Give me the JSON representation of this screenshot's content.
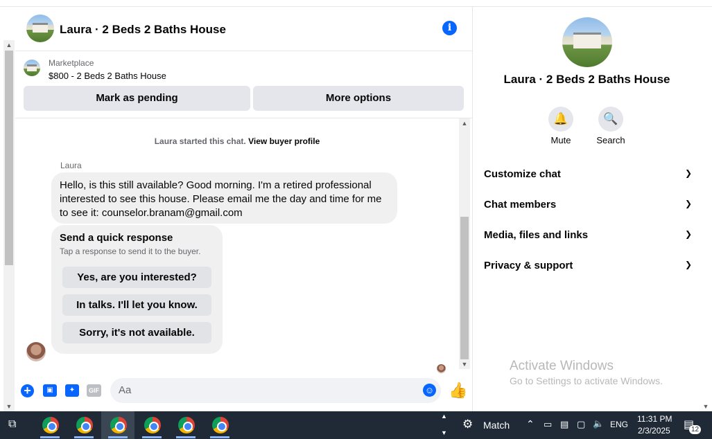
{
  "header": {
    "title": "Laura · 2 Beds 2 Baths House"
  },
  "listing": {
    "source": "Marketplace",
    "price_title": "$800 - 2 Beds 2 Baths House",
    "mark_pending": "Mark as pending",
    "more_options": "More options"
  },
  "messages": {
    "started_text": "Laura started this chat.",
    "view_profile": "View buyer profile",
    "sender": "Laura",
    "message_text": "Hello, is this still available? Good morning. I'm a retired professional interested to see this house. Please email me the day and time for me to see it: counselor.branam@gmail.com",
    "quick_title": "Send a quick response",
    "quick_subtitle": "Tap a response to send it to the buyer.",
    "quick_responses": [
      "Yes, are you interested?",
      "In talks. I'll let you know.",
      "Sorry, it's not available."
    ]
  },
  "composer": {
    "placeholder": "Aa",
    "gif_label": "GIF"
  },
  "right_panel": {
    "title": "Laura · 2 Beds 2 Baths House",
    "mute": "Mute",
    "search": "Search",
    "sections": [
      "Customize chat",
      "Chat members",
      "Media, files and links",
      "Privacy & support"
    ]
  },
  "watermark": {
    "line1": "Activate Windows",
    "line2": "Go to Settings to activate Windows."
  },
  "taskbar": {
    "app_label": "Match",
    "language": "ENG",
    "time": "11:31 PM",
    "date": "2/3/2025",
    "notification_count": "12"
  },
  "colors": {
    "accent": "#0866ff",
    "taskbar": "#1f2a36",
    "button_bg": "#e4e6eb"
  }
}
